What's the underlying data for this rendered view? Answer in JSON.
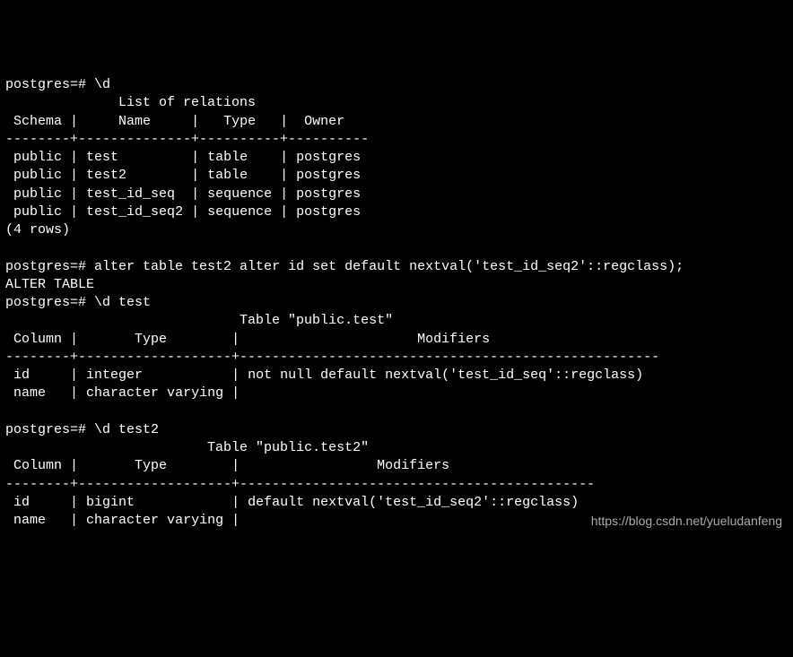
{
  "terminal": {
    "prompt": "postgres=#",
    "cmd1": "\\d",
    "list_title": "List of relations",
    "list_headers": {
      "schema": "Schema",
      "name": "Name",
      "type": "Type",
      "owner": "Owner"
    },
    "list_rows": [
      {
        "schema": "public",
        "name": "test",
        "type": "table",
        "owner": "postgres"
      },
      {
        "schema": "public",
        "name": "test2",
        "type": "table",
        "owner": "postgres"
      },
      {
        "schema": "public",
        "name": "test_id_seq",
        "type": "sequence",
        "owner": "postgres"
      },
      {
        "schema": "public",
        "name": "test_id_seq2",
        "type": "sequence",
        "owner": "postgres"
      }
    ],
    "list_rowcount": "(4 rows)",
    "cmd2": "alter table test2 alter id set default nextval('test_id_seq2'::regclass);",
    "cmd2_response": "ALTER TABLE",
    "cmd3": "\\d test",
    "table1_title": "Table \"public.test\"",
    "table_headers": {
      "column": "Column",
      "type": "Type",
      "modifiers": "Modifiers"
    },
    "table1_rows": [
      {
        "column": "id",
        "type": "integer",
        "modifiers": "not null default nextval('test_id_seq'::regclass)"
      },
      {
        "column": "name",
        "type": "character varying",
        "modifiers": ""
      }
    ],
    "cmd4": "\\d test2",
    "table2_title": "Table \"public.test2\"",
    "table2_rows": [
      {
        "column": "id",
        "type": "bigint",
        "modifiers": "default nextval('test_id_seq2'::regclass)"
      },
      {
        "column": "name",
        "type": "character varying",
        "modifiers": ""
      }
    ]
  },
  "watermark": "https://blog.csdn.net/yueludanfeng"
}
